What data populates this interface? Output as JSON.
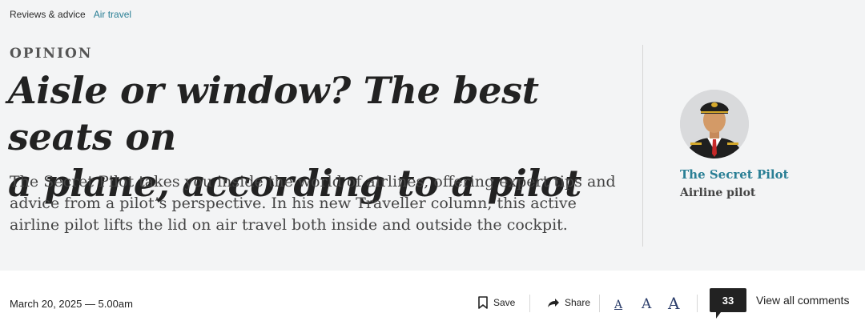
{
  "breadcrumb": {
    "section": "Reviews & advice",
    "subsection": "Air travel"
  },
  "article": {
    "kicker": "OPINION",
    "headline_line1": "Aisle or window? The best seats on",
    "headline_line2": "a plane, according to a pilot",
    "standfirst": "The Secret Pilot takes you inside the world of airlines, offering expert tips and advice from a pilot’s perspective. In his new Traveller column, this active airline pilot lifts the lid on air travel both inside and outside the cockpit."
  },
  "author": {
    "name": "The Secret Pilot",
    "role": "Airline pilot"
  },
  "meta": {
    "published": "March 20, 2025 — 5.00am"
  },
  "toolbar": {
    "save_label": "Save",
    "share_label": "Share",
    "font_small": "A",
    "font_medium": "A",
    "font_large": "A",
    "comment_count": "33",
    "comments_label": "View all comments"
  },
  "colors": {
    "accent": "#2a7f95",
    "hero_bg": "#f3f4f5",
    "font_icon": "#2c3e6b"
  }
}
